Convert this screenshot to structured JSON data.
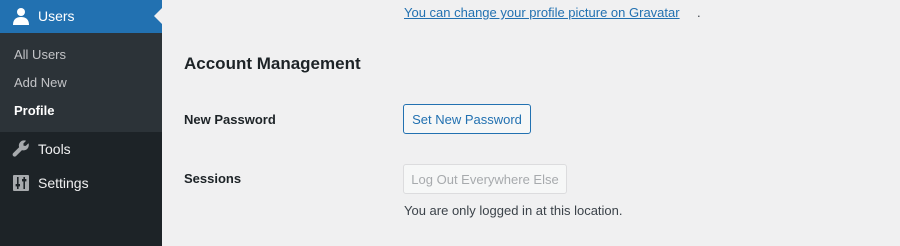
{
  "admin_menu": {
    "current_section": {
      "label": "Users",
      "icon": "user-icon",
      "background": "#2271b1"
    },
    "submenu": [
      {
        "label": "All Users",
        "current": false
      },
      {
        "label": "Add New",
        "current": false
      },
      {
        "label": "Profile",
        "current": true
      }
    ],
    "items": [
      {
        "label": "Tools",
        "icon": "wrench-icon"
      },
      {
        "label": "Settings",
        "icon": "settings-sliders-icon"
      }
    ]
  },
  "profile_picture": {
    "gravatar_link_text": "You can change your profile picture on Gravatar",
    "trailing_period": "."
  },
  "account_management": {
    "title": "Account Management",
    "new_password_label": "New Password",
    "set_new_password_button": "Set New Password",
    "sessions_label": "Sessions",
    "log_out_everywhere_button": "Log Out Everywhere Else",
    "sessions_help_text": "You are only logged in at this location."
  },
  "colors": {
    "accent": "#2271b1",
    "menu_background": "#1d2327",
    "submenu_background": "#2c3338",
    "page_background": "#f0f0f1"
  }
}
